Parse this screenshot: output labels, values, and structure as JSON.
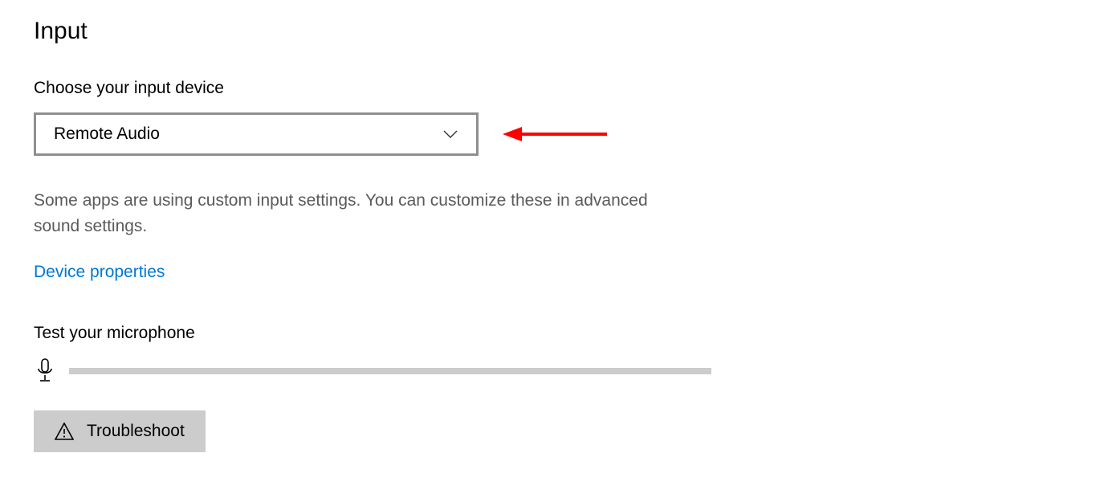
{
  "section": {
    "title": "Input",
    "choose_label": "Choose your input device",
    "dropdown_value": "Remote Audio",
    "description": "Some apps are using custom input settings. You can customize these in advanced sound settings.",
    "device_properties_link": "Device properties",
    "test_mic_label": "Test your microphone",
    "troubleshoot_label": "Troubleshoot"
  }
}
